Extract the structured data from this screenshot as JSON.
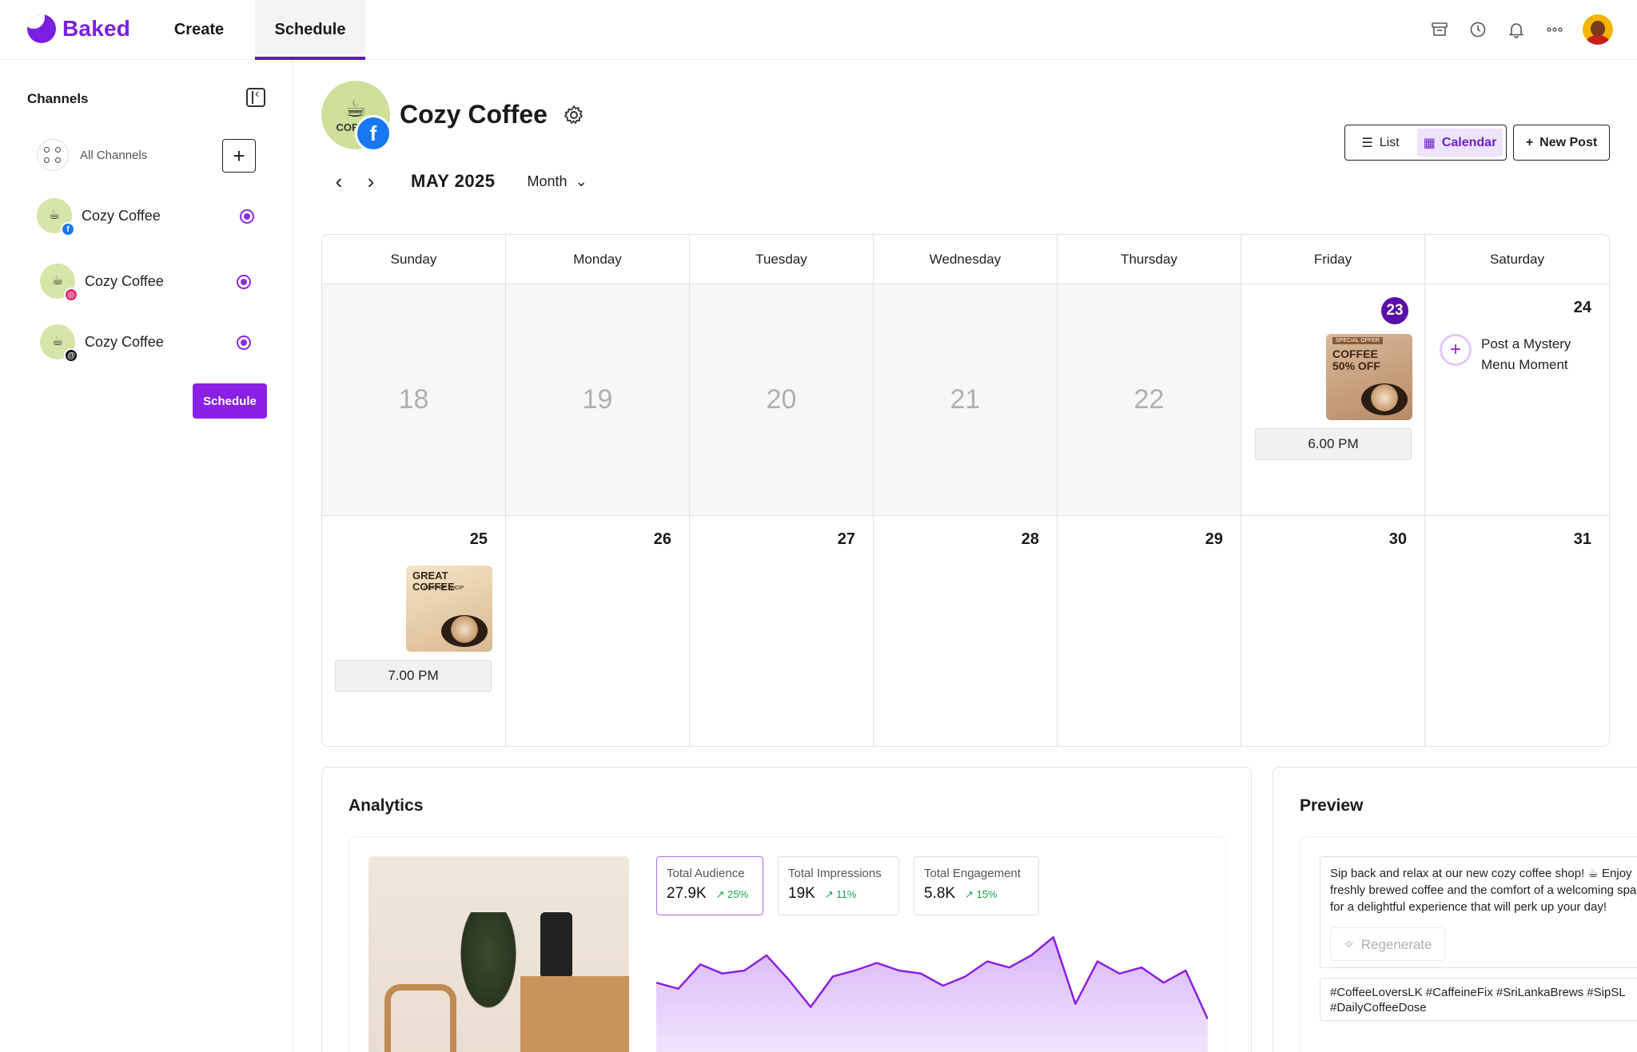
{
  "app": {
    "name": "Baked",
    "brand_color": "#7a1fe0"
  },
  "nav": {
    "tabs": [
      {
        "label": "Create"
      },
      {
        "label": "Schedule",
        "active": true
      }
    ]
  },
  "top_icons": [
    "archive-icon",
    "clock-icon",
    "bell-icon",
    "more-icon",
    "user-avatar"
  ],
  "sidebar": {
    "title": "Channels",
    "all_channels_label": "All Channels",
    "channels": [
      {
        "name": "Cozy Coffee",
        "network": "facebook",
        "badge_color": "#1877f2",
        "selected": true
      },
      {
        "name": "Cozy Coffee",
        "network": "instagram",
        "badge_color": "#e1306c",
        "selected": true
      },
      {
        "name": "Cozy Coffee",
        "network": "threads",
        "badge_color": "#111111",
        "selected": true
      }
    ],
    "schedule_button": "Schedule"
  },
  "page": {
    "title": "Cozy Coffee",
    "avatar_text": "COF SH",
    "view_toggle": {
      "list": "List",
      "calendar": "Calendar",
      "active": "calendar"
    },
    "new_post": "New Post",
    "month_label": "MAY 2025",
    "period": "Month"
  },
  "calendar": {
    "weekdays": [
      "Sunday",
      "Monday",
      "Tuesday",
      "Wednesday",
      "Thursday",
      "Friday",
      "Saturday"
    ],
    "week1": [
      {
        "day": "18",
        "past": true
      },
      {
        "day": "19",
        "past": true
      },
      {
        "day": "20",
        "past": true
      },
      {
        "day": "21",
        "past": true
      },
      {
        "day": "22",
        "past": true
      },
      {
        "day": "23",
        "today": true,
        "post": {
          "thumb_top": "SPECIAL OFFER",
          "thumb_title": "COFFEE 50% OFF",
          "time": "6.00 PM"
        }
      },
      {
        "day": "24",
        "suggestion": "Post a Mystery Menu Moment"
      }
    ],
    "week2": [
      {
        "day": "25",
        "post": {
          "thumb_top": "COFFEE SHOP",
          "thumb_title": "GREAT COFFEE",
          "time": "7.00 PM"
        }
      },
      {
        "day": "26"
      },
      {
        "day": "27"
      },
      {
        "day": "28"
      },
      {
        "day": "29"
      },
      {
        "day": "30"
      },
      {
        "day": "31"
      }
    ]
  },
  "analytics": {
    "title": "Analytics",
    "stats": [
      {
        "label": "Total Audience",
        "value": "27.9K",
        "change": "↗ 25%",
        "active": true
      },
      {
        "label": "Total Impressions",
        "value": "19K",
        "change": "↗ 11%"
      },
      {
        "label": "Total Engagement",
        "value": "5.8K",
        "change": "↗ 15%"
      }
    ],
    "sparkline_values": [
      62,
      58,
      74,
      68,
      70,
      80,
      64,
      46,
      66,
      70,
      75,
      70,
      68,
      60,
      66,
      76,
      72,
      80,
      92,
      48,
      76,
      68,
      72,
      62,
      70,
      38
    ],
    "line_color": "#8a1fe6"
  },
  "preview": {
    "title": "Preview",
    "caption_lines": [
      "Sip back and relax at our new cozy coffee shop! ☕ Enjoy",
      "freshly brewed coffee and the comfort of a welcoming space",
      "for a delightful experience that will perk up your day!"
    ],
    "regenerate": "Regenerate",
    "hashtag_lines": [
      "#CoffeeLoversLK #CaffeineFix #SriLankaBrews #SipSL",
      "#DailyCoffeeDose"
    ]
  }
}
